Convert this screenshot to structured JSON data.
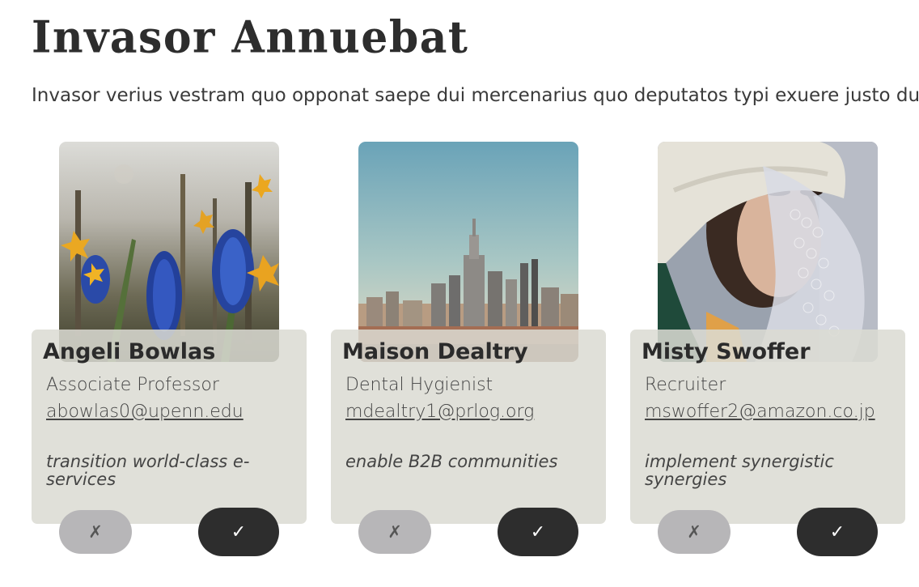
{
  "header": {
    "title": "Invasor Annuebat",
    "intro": "Invasor verius vestram quo opponat saepe dui mercenarius quo deputatos typi exuere justo du"
  },
  "cards": [
    {
      "name": "Angeli Bowlas",
      "role": "Associate Professor",
      "email": "abowlas0@upenn.edu",
      "tagline": "transition world-class e-services",
      "photo_icon": "flowers-photo",
      "reject_label": "✗",
      "accept_label": "✓"
    },
    {
      "name": "Maison Dealtry",
      "role": "Dental Hygienist",
      "email": "mdealtry1@prlog.org",
      "tagline": "enable B2B communities",
      "photo_icon": "city-skyline-photo",
      "reject_label": "✗",
      "accept_label": "✓"
    },
    {
      "name": "Misty Swoffer",
      "role": "Recruiter",
      "email": "mswoffer2@amazon.co.jp",
      "tagline": "implement synergistic synergies",
      "photo_icon": "portrait-photo",
      "reject_label": "✗",
      "accept_label": "✓"
    }
  ],
  "colors": {
    "card_panel": "#dbdbd3",
    "accept_button": "#2d2d2d",
    "reject_button": "#b7b6b8",
    "text": "#333333"
  }
}
